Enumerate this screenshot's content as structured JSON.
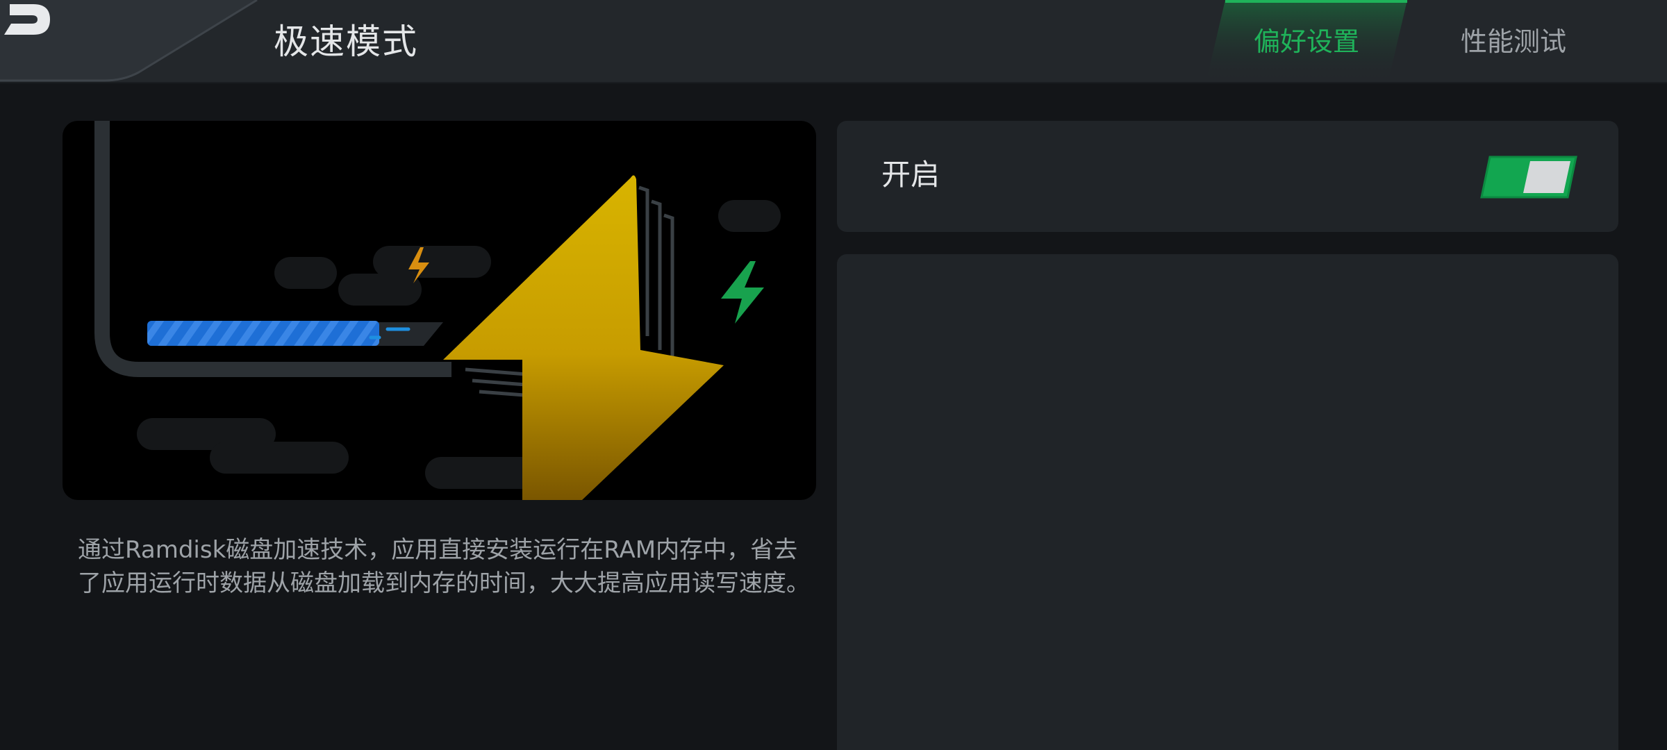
{
  "header": {
    "title": "极速模式",
    "back_icon": "back-arrow-icon",
    "tabs": [
      {
        "label": "偏好设置",
        "active": true
      },
      {
        "label": "性能测试",
        "active": false
      }
    ]
  },
  "main": {
    "illustration_icon": "lightning-speed-illustration",
    "description": "通过Ramdisk磁盘加速技术，应用直接安装运行在RAM内存中，省去了应用运行时数据从磁盘加载到内存的时间，大大提高应用读写速度。"
  },
  "settings": {
    "toggle_label": "开启",
    "toggle_on": true
  },
  "colors": {
    "accent": "#1fb35a",
    "toggle_on": "#12a650",
    "bolt": "#d6b000",
    "progress": "#1e6fd6",
    "background": "#131518",
    "panel": "#202428",
    "topbar": "#23272b"
  }
}
